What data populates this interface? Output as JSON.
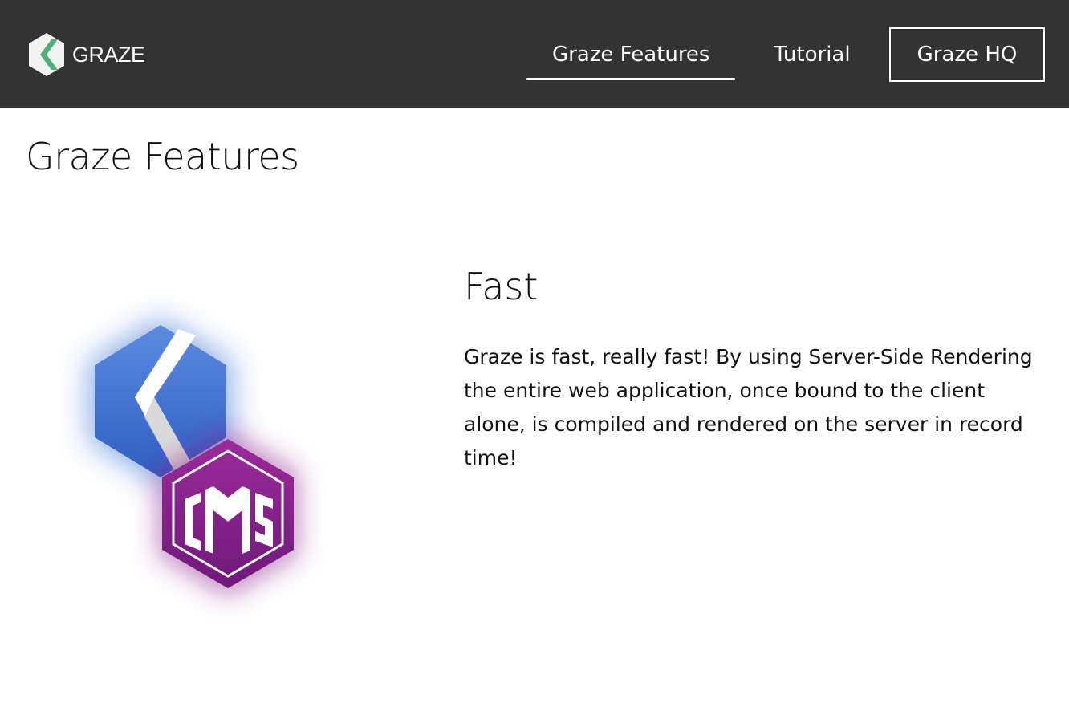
{
  "navbar": {
    "brand_text": "GRAZE",
    "links": [
      {
        "label": "Graze Features"
      },
      {
        "label": "Tutorial"
      },
      {
        "label": "Graze HQ"
      }
    ]
  },
  "page": {
    "title": "Graze Features"
  },
  "feature": {
    "image_icon": "graze-cms-logo",
    "image_text": "CMS",
    "title": "Fast",
    "body": "Graze is fast, really fast! By using Server-Side Rendering the entire web application, once bound to the client alone, is compiled and rendered on the server in record time!"
  },
  "colors": {
    "navbar_bg": "#333333",
    "brand_green": "#4caf7a",
    "graze_blue": "#3a6fd0",
    "cms_purple": "#8a1f8a"
  }
}
